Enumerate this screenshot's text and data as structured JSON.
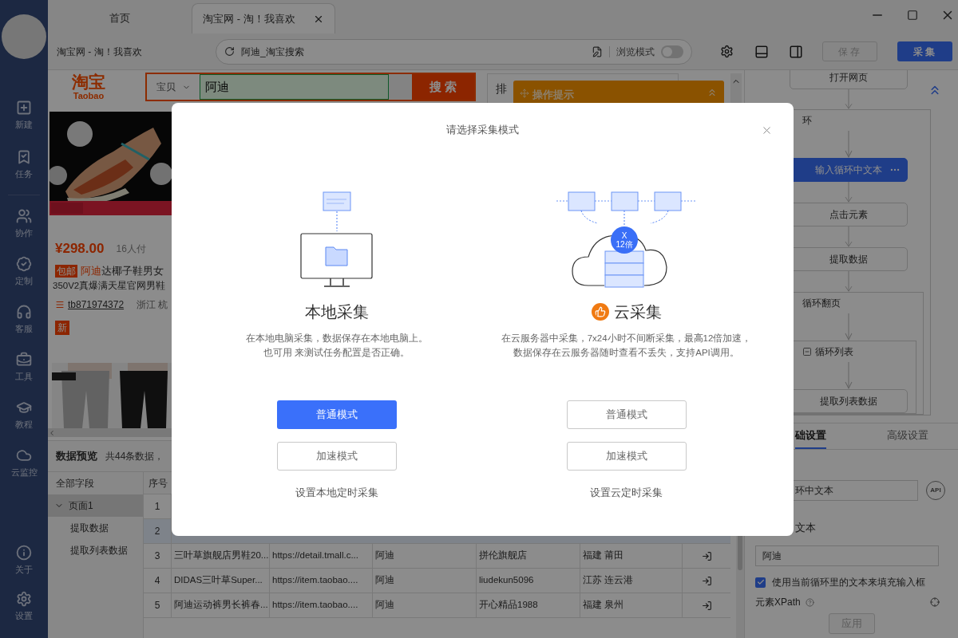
{
  "sidebar": {
    "top": [
      {
        "label": "新建"
      },
      {
        "label": "任务"
      }
    ],
    "middle": [
      {
        "label": "协作"
      },
      {
        "label": "定制"
      },
      {
        "label": "客服"
      },
      {
        "label": "工具"
      },
      {
        "label": "教程"
      },
      {
        "label": "云监控"
      }
    ],
    "bottom": [
      {
        "label": "关于"
      },
      {
        "label": "设置"
      }
    ]
  },
  "tabs": [
    {
      "label": "首页",
      "selected": false,
      "closable": false
    },
    {
      "label": "淘宝网 - 淘！我喜欢",
      "selected": true,
      "closable": true
    }
  ],
  "toolbar": {
    "page_title": "淘宝网 - 淘！我喜欢",
    "address": "阿迪_淘宝搜索",
    "browse_mode": {
      "label": "浏览模式",
      "on": false
    },
    "save": {
      "label": "保存",
      "disabled": true
    },
    "collect": {
      "label": "采集",
      "disabled": false
    }
  },
  "webpage": {
    "logo": {
      "text": "淘宝",
      "subtext": "Taobao"
    },
    "search": {
      "category": "宝贝",
      "value": "阿迪",
      "button": "搜 索"
    },
    "filter_label": "排",
    "tip": {
      "title": "操作提示"
    },
    "product": {
      "price": "¥298.00",
      "buyers": "16人付",
      "badge": "包邮",
      "keyword": "阿迪",
      "title_rest": "达椰子鞋男女",
      "title_line2": "350V2真爆满天星官网男鞋",
      "shop": "tb871974372",
      "location": "浙江 杭",
      "new_badge": "新"
    }
  },
  "data_preview": {
    "title": "数据预览",
    "count": "共44条数据，",
    "tree": [
      {
        "label": "全部字段",
        "selected": false
      },
      {
        "label": "页面1",
        "selected": true,
        "expanded": true,
        "children": [
          {
            "label": "提取数据",
            "selected": false
          },
          {
            "label": "提取列表数据",
            "selected": false
          }
        ]
      }
    ],
    "table": {
      "columns": [
        "序号"
      ],
      "rows": [
        {
          "index": "1",
          "selected": false
        },
        {
          "index": "2",
          "selected": true
        },
        {
          "index": "3",
          "selected": false,
          "cells": [
            "三叶草旗舰店男鞋20...",
            "https://detail.tmall.c...",
            "阿迪",
            "拼伦旗舰店",
            "福建 莆田"
          ]
        },
        {
          "index": "4",
          "selected": false,
          "cells": [
            "DIDAS三叶草Super...",
            "https://item.taobao....",
            "阿迪",
            "liudekun5096",
            "江苏 连云港"
          ]
        },
        {
          "index": "5",
          "selected": false,
          "cells": [
            "阿迪运动裤男长裤春...",
            "https://item.taobao....",
            "阿迪",
            "开心精品1988",
            "福建 泉州"
          ]
        }
      ]
    }
  },
  "flow": [
    {
      "kind": "step",
      "label": "打开网页",
      "selected": false
    },
    {
      "kind": "loop",
      "label": "环",
      "toggle": false,
      "children": [
        {
          "kind": "step",
          "label": "输入循环中文本",
          "selected": true
        },
        {
          "kind": "step",
          "label": "点击元素",
          "selected": false
        },
        {
          "kind": "step",
          "label": "提取数据",
          "selected": false
        },
        {
          "kind": "loop",
          "label": "循环翻页",
          "toggle": false,
          "children": [
            {
              "kind": "loop",
              "label": "循环列表",
              "toggle": true,
              "children": [
                {
                  "kind": "step",
                  "label": "提取列表数据",
                  "selected": false
                }
              ]
            }
          ]
        }
      ]
    }
  ],
  "settings": {
    "tabs": [
      {
        "label": "础设置",
        "selected": true
      },
      {
        "label": "高级设置",
        "selected": false
      }
    ],
    "name_value": "环中文本",
    "api_badge": "API",
    "text_label": "文本",
    "text_value": "阿迪",
    "fill_checkbox": {
      "label": "使用当前循环里的文本来填充输入框",
      "checked": true
    },
    "xpath_label": "元素XPath",
    "apply": {
      "label": "应用",
      "disabled": true
    }
  },
  "modal": {
    "title": "请选择采集模式",
    "options": [
      {
        "kind": "local",
        "title": "本地采集",
        "description": [
          "在本地电脑采集，数据保存在本地电脑上。",
          "也可用 来测试任务配置是否正确。"
        ],
        "buttons": [
          {
            "label": "普通模式",
            "primary": true
          },
          {
            "label": "加速模式",
            "primary": false
          }
        ],
        "schedule": "设置本地定时采集"
      },
      {
        "kind": "cloud",
        "title": "云采集",
        "boost_badge": {
          "top": "X",
          "bottom": "12倍"
        },
        "description": [
          "在云服务器中采集，7x24小时不间断采集，最高12倍加速，",
          "数据保存在云服务器随时查看不丢失，支持API调用。"
        ],
        "buttons": [
          {
            "label": "普通模式",
            "primary": false
          },
          {
            "label": "加速模式",
            "primary": false
          }
        ],
        "schedule": "设置云定时采集"
      }
    ]
  }
}
